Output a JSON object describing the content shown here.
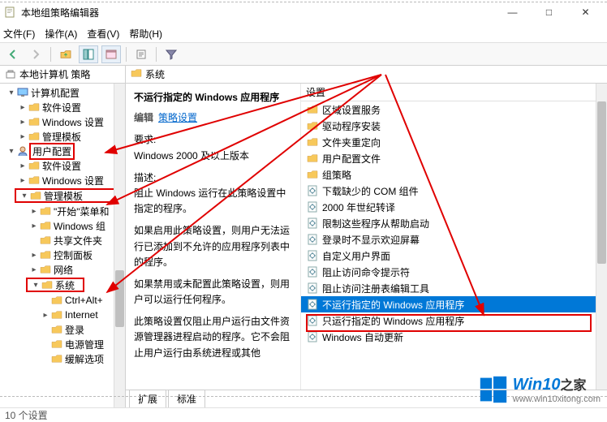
{
  "window": {
    "title": "本地组策略编辑器"
  },
  "menu": {
    "file": "文件(F)",
    "action": "操作(A)",
    "view": "查看(V)",
    "help": "帮助(H)"
  },
  "tree": {
    "header": "本地计算机 策略",
    "computer_config": "计算机配置",
    "software_settings1": "软件设置",
    "windows_settings1": "Windows 设置",
    "admin_templates1": "管理模板",
    "user_config": "用户配置",
    "software_settings2": "软件设置",
    "windows_settings2": "Windows 设置",
    "admin_templates2": "管理模板",
    "start_menu": "\"开始\"菜单和",
    "windows_components": "Windows 组",
    "shared_folders": "共享文件夹",
    "control_panel": "控制面板",
    "network": "网络",
    "system": "系统",
    "ctrl_alt": "Ctrl+Alt+",
    "internet": "Internet",
    "logon": "登录",
    "power_mgmt": "电源管理",
    "mitigation": "缓解选项"
  },
  "main": {
    "header": "系统"
  },
  "detail": {
    "policy_name": "不运行指定的 Windows 应用程序",
    "edit_label": "编辑",
    "edit_link": "策略设置",
    "req_label": "要求:",
    "req_text": "Windows 2000 及以上版本",
    "desc_label": "描述:",
    "desc1": "阻止 Windows 运行在此策略设置中指定的程序。",
    "desc2": "如果启用此策略设置，则用户无法运行已添加到不允许的应用程序列表中的程序。",
    "desc3": "如果禁用或未配置此策略设置，则用户可以运行任何程序。",
    "desc4": "此策略设置仅阻止用户运行由文件资源管理器进程启动的程序。它不会阻止用户运行由系统进程或其他"
  },
  "list": {
    "header": "设置",
    "items": [
      {
        "t": "folder",
        "label": "区域设置服务"
      },
      {
        "t": "folder",
        "label": "驱动程序安装"
      },
      {
        "t": "folder",
        "label": "文件夹重定向"
      },
      {
        "t": "folder",
        "label": "用户配置文件"
      },
      {
        "t": "folder",
        "label": "组策略"
      },
      {
        "t": "setting",
        "label": "下载缺少的 COM 组件"
      },
      {
        "t": "setting",
        "label": "2000 年世纪转译"
      },
      {
        "t": "setting",
        "label": "限制这些程序从帮助启动"
      },
      {
        "t": "setting",
        "label": "登录时不显示欢迎屏幕"
      },
      {
        "t": "setting",
        "label": "自定义用户界面"
      },
      {
        "t": "setting",
        "label": "阻止访问命令提示符"
      },
      {
        "t": "setting",
        "label": "阻止访问注册表编辑工具"
      },
      {
        "t": "setting",
        "label": "不运行指定的 Windows 应用程序",
        "selected": true
      },
      {
        "t": "setting",
        "label": "只运行指定的 Windows 应用程序"
      },
      {
        "t": "setting",
        "label": "Windows 自动更新"
      }
    ]
  },
  "tabs": {
    "extended": "扩展",
    "standard": "标准"
  },
  "status": {
    "text": "10 个设置"
  },
  "watermark": {
    "brand": "Win10",
    "suffix": "之家",
    "url": "www.win10xitong.com"
  }
}
